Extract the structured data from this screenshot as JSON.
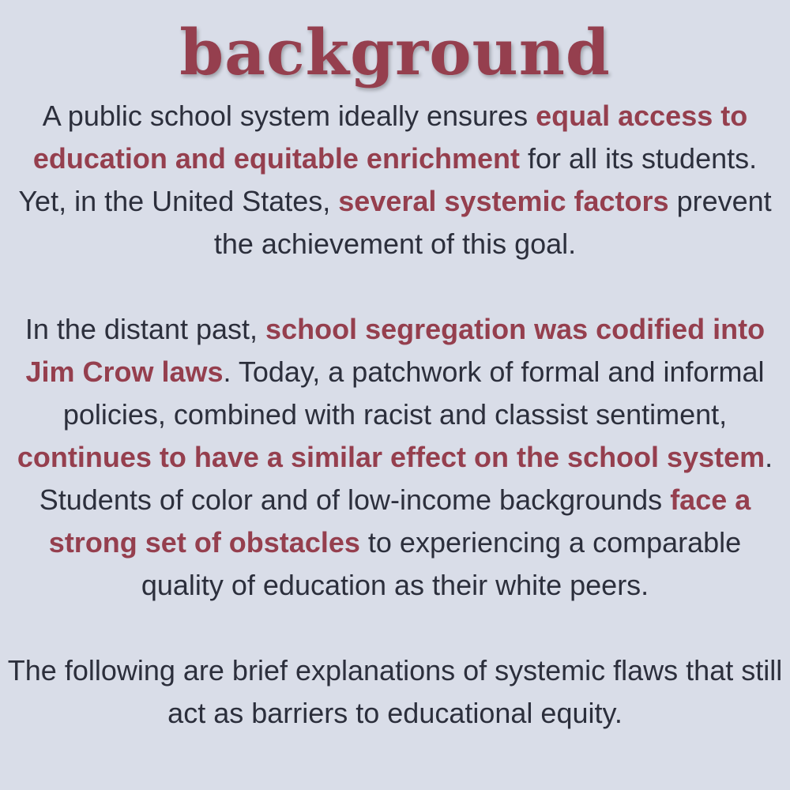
{
  "title": "background",
  "paragraphs": [
    [
      {
        "text": "A public school system ideally ensures ",
        "highlight": false
      },
      {
        "text": "equal access to education and equitable enrichment",
        "highlight": true
      },
      {
        "text": " for all its students. Yet, in the United States, ",
        "highlight": false
      },
      {
        "text": "several systemic factors",
        "highlight": true
      },
      {
        "text": " prevent the achievement of this goal.",
        "highlight": false
      }
    ],
    [
      {
        "text": "In the distant past, ",
        "highlight": false
      },
      {
        "text": "school segregation was codified into Jim Crow laws",
        "highlight": true
      },
      {
        "text": ". Today, a patchwork of formal and informal policies, combined with racist and classist sentiment, ",
        "highlight": false
      },
      {
        "text": "continues to have a similar effect on the school system",
        "highlight": true
      },
      {
        "text": ". Students of color and of low-income backgrounds ",
        "highlight": false
      },
      {
        "text": "face a strong set of obstacles",
        "highlight": true
      },
      {
        "text": " to experiencing a comparable quality of education as their white peers.",
        "highlight": false
      }
    ],
    [
      {
        "text": "The following are brief explanations of systemic flaws that still act as barriers to educational equity.",
        "highlight": false
      }
    ]
  ],
  "colors": {
    "background": "#d9dde8",
    "accent": "#953f4e",
    "body_text": "#2c2f3c"
  }
}
